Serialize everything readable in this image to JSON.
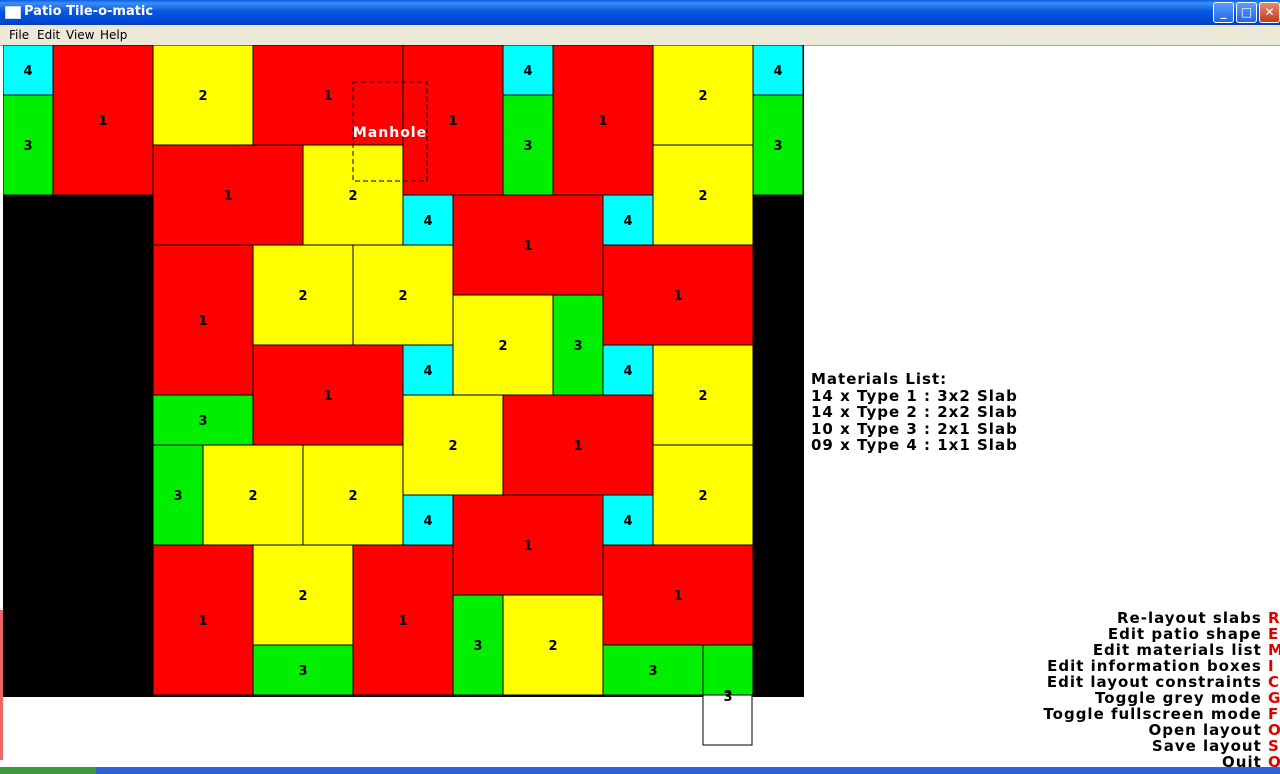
{
  "window": {
    "title": "Patio Tile-o-matic",
    "min_icon": "minimize-icon",
    "max_icon": "maximize-icon",
    "close_icon": "close-icon",
    "app_icon": "window-icon"
  },
  "menu": [
    "File",
    "Edit",
    "View",
    "Help"
  ],
  "colors": {
    "type1": "#ff0000",
    "type2": "#ffff00",
    "type3": "#00ee00",
    "type4": "#00ffff",
    "void": "#000000",
    "control_key": "#e00000"
  },
  "patio": {
    "manhole_label": "Manhole",
    "slabs": [
      {
        "type": "4",
        "c": 0,
        "r": 0,
        "w": 1,
        "h": 1
      },
      {
        "type": "3",
        "c": 0,
        "r": 1,
        "w": 1,
        "h": 2
      },
      {
        "type": "1",
        "c": 1,
        "r": 0,
        "w": 2,
        "h": 3
      },
      {
        "type": "2",
        "c": 3,
        "r": 0,
        "w": 2,
        "h": 2
      },
      {
        "type": "1",
        "c": 5,
        "r": 0,
        "w": 3,
        "h": 2
      },
      {
        "type": "1",
        "c": 8,
        "r": 0,
        "w": 2,
        "h": 3
      },
      {
        "type": "4",
        "c": 10,
        "r": 0,
        "w": 1,
        "h": 1
      },
      {
        "type": "3",
        "c": 10,
        "r": 1,
        "w": 1,
        "h": 2
      },
      {
        "type": "1",
        "c": 11,
        "r": 0,
        "w": 2,
        "h": 3
      },
      {
        "type": "2",
        "c": 13,
        "r": 0,
        "w": 2,
        "h": 2
      },
      {
        "type": "4",
        "c": 15,
        "r": 0,
        "w": 1,
        "h": 1
      },
      {
        "type": "3",
        "c": 15,
        "r": 1,
        "w": 1,
        "h": 2
      },
      {
        "type": "1",
        "c": 3,
        "r": 2,
        "w": 3,
        "h": 2
      },
      {
        "type": "2",
        "c": 6,
        "r": 2,
        "w": 2,
        "h": 2
      },
      {
        "type": "2",
        "c": 13,
        "r": 2,
        "w": 2,
        "h": 2
      },
      {
        "type": "4",
        "c": 8,
        "r": 3,
        "w": 1,
        "h": 1
      },
      {
        "type": "1",
        "c": 9,
        "r": 3,
        "w": 3,
        "h": 2
      },
      {
        "type": "4",
        "c": 12,
        "r": 3,
        "w": 1,
        "h": 1
      },
      {
        "type": "1",
        "c": 3,
        "r": 4,
        "w": 2,
        "h": 3
      },
      {
        "type": "2",
        "c": 5,
        "r": 4,
        "w": 2,
        "h": 2
      },
      {
        "type": "2",
        "c": 7,
        "r": 4,
        "w": 2,
        "h": 2
      },
      {
        "type": "1",
        "c": 12,
        "r": 4,
        "w": 3,
        "h": 2
      },
      {
        "type": "2",
        "c": 9,
        "r": 5,
        "w": 2,
        "h": 2
      },
      {
        "type": "3",
        "c": 11,
        "r": 5,
        "w": 1,
        "h": 2
      },
      {
        "type": "1",
        "c": 5,
        "r": 6,
        "w": 3,
        "h": 2
      },
      {
        "type": "4",
        "c": 8,
        "r": 6,
        "w": 1,
        "h": 1
      },
      {
        "type": "4",
        "c": 12,
        "r": 6,
        "w": 1,
        "h": 1
      },
      {
        "type": "2",
        "c": 13,
        "r": 6,
        "w": 2,
        "h": 2
      },
      {
        "type": "3",
        "c": 3,
        "r": 7,
        "w": 2,
        "h": 1
      },
      {
        "type": "2",
        "c": 8,
        "r": 7,
        "w": 2,
        "h": 2
      },
      {
        "type": "1",
        "c": 10,
        "r": 7,
        "w": 3,
        "h": 2
      },
      {
        "type": "3",
        "c": 3,
        "r": 8,
        "w": 1,
        "h": 2
      },
      {
        "type": "2",
        "c": 4,
        "r": 8,
        "w": 2,
        "h": 2
      },
      {
        "type": "2",
        "c": 6,
        "r": 8,
        "w": 2,
        "h": 2
      },
      {
        "type": "2",
        "c": 13,
        "r": 8,
        "w": 2,
        "h": 2
      },
      {
        "type": "4",
        "c": 8,
        "r": 9,
        "w": 1,
        "h": 1
      },
      {
        "type": "1",
        "c": 9,
        "r": 9,
        "w": 3,
        "h": 2
      },
      {
        "type": "4",
        "c": 12,
        "r": 9,
        "w": 1,
        "h": 1
      },
      {
        "type": "1",
        "c": 3,
        "r": 10,
        "w": 2,
        "h": 3
      },
      {
        "type": "2",
        "c": 5,
        "r": 10,
        "w": 2,
        "h": 2
      },
      {
        "type": "1",
        "c": 7,
        "r": 10,
        "w": 2,
        "h": 3
      },
      {
        "type": "1",
        "c": 12,
        "r": 10,
        "w": 3,
        "h": 2
      },
      {
        "type": "3",
        "c": 9,
        "r": 11,
        "w": 1,
        "h": 2
      },
      {
        "type": "2",
        "c": 10,
        "r": 11,
        "w": 2,
        "h": 2
      },
      {
        "type": "3",
        "c": 5,
        "r": 12,
        "w": 2,
        "h": 1
      },
      {
        "type": "3",
        "c": 12,
        "r": 12,
        "w": 2,
        "h": 1
      },
      {
        "type": "3",
        "c": 14,
        "r": 12,
        "w": 1,
        "h": 2
      }
    ]
  },
  "materials": {
    "heading": "Materials List:",
    "lines": [
      "14 x Type 1 : 3x2 Slab",
      "14 x Type 2 : 2x2 Slab",
      "10 x Type 3 : 2x1 Slab",
      "09 x Type 4 : 1x1 Slab"
    ]
  },
  "controls": [
    {
      "label": "Re-layout slabs",
      "key": "R"
    },
    {
      "label": "Edit patio shape",
      "key": "E"
    },
    {
      "label": "Edit materials list",
      "key": "M"
    },
    {
      "label": "Edit information boxes",
      "key": "I"
    },
    {
      "label": "Edit layout constraints",
      "key": "C"
    },
    {
      "label": "Toggle grey mode",
      "key": "G"
    },
    {
      "label": "Toggle fullscreen mode",
      "key": "F"
    },
    {
      "label": "Open layout",
      "key": "O"
    },
    {
      "label": "Save layout",
      "key": "S"
    },
    {
      "label": "Quit",
      "key": "Q"
    }
  ]
}
